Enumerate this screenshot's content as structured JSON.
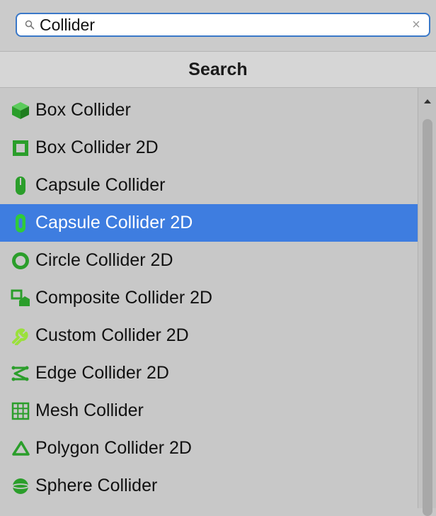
{
  "search": {
    "query": "Collider",
    "clear_glyph": "×"
  },
  "header": {
    "title": "Search"
  },
  "colors": {
    "accent_selected": "#3e7de0",
    "icon_green": "#2b9e2b",
    "icon_light_green": "#9be03c"
  },
  "items": [
    {
      "label": "Box Collider",
      "icon": "box-collider-icon"
    },
    {
      "label": "Box Collider 2D",
      "icon": "box-collider-2d-icon"
    },
    {
      "label": "Capsule Collider",
      "icon": "capsule-collider-icon"
    },
    {
      "label": "Capsule Collider 2D",
      "icon": "capsule-collider-2d-icon",
      "selected": true
    },
    {
      "label": "Circle Collider 2D",
      "icon": "circle-collider-2d-icon"
    },
    {
      "label": "Composite Collider 2D",
      "icon": "composite-collider-2d-icon"
    },
    {
      "label": "Custom Collider 2D",
      "icon": "custom-collider-2d-icon"
    },
    {
      "label": "Edge Collider 2D",
      "icon": "edge-collider-2d-icon"
    },
    {
      "label": "Mesh Collider",
      "icon": "mesh-collider-icon"
    },
    {
      "label": "Polygon Collider 2D",
      "icon": "polygon-collider-2d-icon"
    },
    {
      "label": "Sphere Collider",
      "icon": "sphere-collider-icon"
    }
  ]
}
